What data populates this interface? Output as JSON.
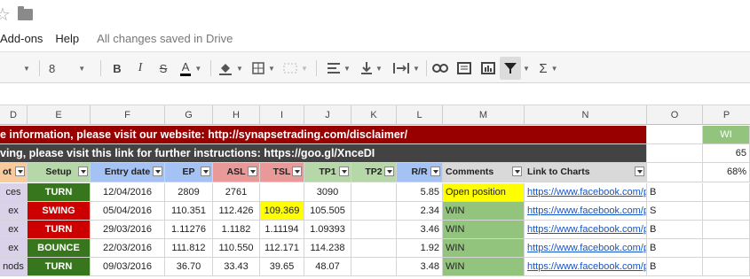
{
  "menu": {
    "items": [
      "Add-ons",
      "Help"
    ],
    "status": "All changes saved in Drive"
  },
  "toolbar": {
    "font_size": "8"
  },
  "columns": [
    "D",
    "E",
    "F",
    "G",
    "H",
    "I",
    "J",
    "K",
    "L",
    "M",
    "N",
    "O",
    "P"
  ],
  "banner1": "e information, please visit our website: http://synapsetrading.com/disclaimer/",
  "banner2": "ving, please visit this link for further instructions: https://goo.gl/XnceDI",
  "side": {
    "p1": "WI",
    "p2": "65",
    "p3": "68%"
  },
  "headers": [
    "ot",
    "Setup",
    "Entry date",
    "EP",
    "ASL",
    "TSL",
    "TP1",
    "TP2",
    "R/R",
    "Comments",
    "Link to Charts"
  ],
  "rows": [
    {
      "d": "ces",
      "setup": "TURN",
      "setup_color": "#38761d",
      "date": "12/04/2016",
      "ep": "2809",
      "asl": "2761",
      "tsl": "",
      "tp1": "3090",
      "tp2": "",
      "rr": "5.85",
      "comment": "Open position",
      "comment_color": "#ffff00",
      "link": "https://www.facebook.com/p",
      "o": "B"
    },
    {
      "d": "ex",
      "setup": "SWING",
      "setup_color": "#cc0000",
      "date": "05/04/2016",
      "ep": "110.351",
      "asl": "112.426",
      "tsl": "109.369",
      "tp1": "105.505",
      "tp2": "",
      "rr": "2.34",
      "comment": "WIN",
      "comment_color": "#93c47d",
      "link": "https://www.facebook.com/p",
      "o": "S"
    },
    {
      "d": "ex",
      "setup": "TURN",
      "setup_color": "#cc0000",
      "date": "29/03/2016",
      "ep": "1.11276",
      "asl": "1.1182",
      "tsl": "1.11194",
      "tp1": "1.09393",
      "tp2": "",
      "rr": "3.46",
      "comment": "WIN",
      "comment_color": "#93c47d",
      "link": "https://www.facebook.com/p",
      "o": "B"
    },
    {
      "d": "ex",
      "setup": "BOUNCE",
      "setup_color": "#38761d",
      "date": "22/03/2016",
      "ep": "111.812",
      "asl": "110.550",
      "tsl": "112.171",
      "tp1": "114.238",
      "tp2": "",
      "rr": "1.92",
      "comment": "WIN",
      "comment_color": "#93c47d",
      "link": "https://www.facebook.com/p",
      "o": "B"
    },
    {
      "d": "nods",
      "setup": "TURN",
      "setup_color": "#38761d",
      "date": "09/03/2016",
      "ep": "36.70",
      "asl": "33.43",
      "tsl": "39.65",
      "tp1": "48.07",
      "tp2": "",
      "rr": "3.48",
      "comment": "WIN",
      "comment_color": "#93c47d",
      "link": "https://www.facebook.com/p",
      "o": "B"
    }
  ]
}
